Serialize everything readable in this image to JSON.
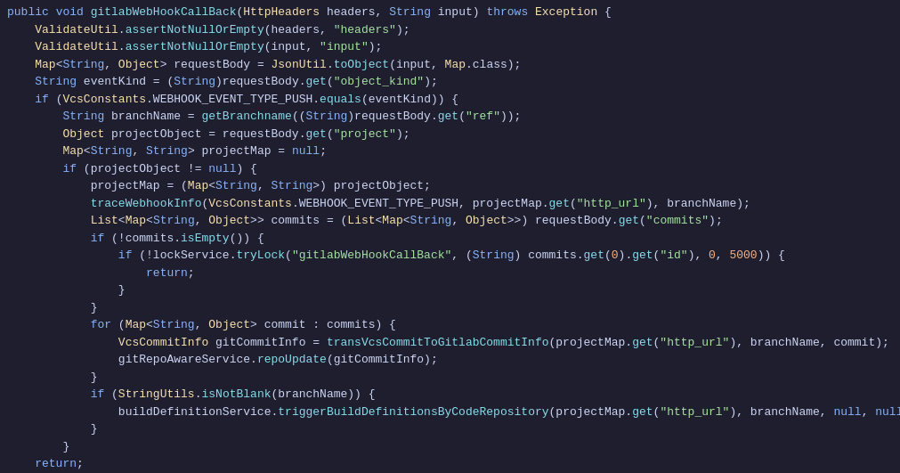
{
  "code": {
    "lines": [
      {
        "indent": 0,
        "tokens": [
          {
            "t": "public",
            "c": "kw"
          },
          {
            "t": " ",
            "c": "plain"
          },
          {
            "t": "void",
            "c": "kw"
          },
          {
            "t": " ",
            "c": "plain"
          },
          {
            "t": "gitlabWebHookCallBack",
            "c": "method"
          },
          {
            "t": "(",
            "c": "plain"
          },
          {
            "t": "HttpHeaders",
            "c": "type"
          },
          {
            "t": " headers, ",
            "c": "plain"
          },
          {
            "t": "String",
            "c": "kw"
          },
          {
            "t": " input) ",
            "c": "plain"
          },
          {
            "t": "throws",
            "c": "kw"
          },
          {
            "t": " ",
            "c": "plain"
          },
          {
            "t": "Exception",
            "c": "type"
          },
          {
            "t": " {",
            "c": "plain"
          }
        ]
      },
      {
        "indent": 1,
        "tokens": [
          {
            "t": "ValidateUtil",
            "c": "type"
          },
          {
            "t": ".",
            "c": "plain"
          },
          {
            "t": "assertNotNullOrEmpty",
            "c": "method"
          },
          {
            "t": "(headers, ",
            "c": "plain"
          },
          {
            "t": "\"headers\"",
            "c": "string"
          },
          {
            "t": ");",
            "c": "plain"
          }
        ]
      },
      {
        "indent": 1,
        "tokens": [
          {
            "t": "ValidateUtil",
            "c": "type"
          },
          {
            "t": ".",
            "c": "plain"
          },
          {
            "t": "assertNotNullOrEmpty",
            "c": "method"
          },
          {
            "t": "(input, ",
            "c": "plain"
          },
          {
            "t": "\"input\"",
            "c": "string"
          },
          {
            "t": ");",
            "c": "plain"
          }
        ]
      },
      {
        "indent": 1,
        "tokens": [
          {
            "t": "Map",
            "c": "type"
          },
          {
            "t": "<",
            "c": "plain"
          },
          {
            "t": "String",
            "c": "kw"
          },
          {
            "t": ", ",
            "c": "plain"
          },
          {
            "t": "Object",
            "c": "type"
          },
          {
            "t": "> requestBody = ",
            "c": "plain"
          },
          {
            "t": "JsonUtil",
            "c": "type"
          },
          {
            "t": ".",
            "c": "plain"
          },
          {
            "t": "toObject",
            "c": "method"
          },
          {
            "t": "(input, ",
            "c": "plain"
          },
          {
            "t": "Map",
            "c": "type"
          },
          {
            "t": ".class);",
            "c": "plain"
          }
        ]
      },
      {
        "indent": 1,
        "tokens": [
          {
            "t": "String",
            "c": "kw"
          },
          {
            "t": " eventKind = (",
            "c": "plain"
          },
          {
            "t": "String",
            "c": "kw"
          },
          {
            "t": ")requestBody.",
            "c": "plain"
          },
          {
            "t": "get",
            "c": "method"
          },
          {
            "t": "(",
            "c": "plain"
          },
          {
            "t": "\"object_kind\"",
            "c": "string"
          },
          {
            "t": ");",
            "c": "plain"
          }
        ]
      },
      {
        "indent": 1,
        "tokens": [
          {
            "t": "if",
            "c": "kw"
          },
          {
            "t": " (",
            "c": "plain"
          },
          {
            "t": "VcsConstants",
            "c": "type"
          },
          {
            "t": ".WEBHOOK_EVENT_TYPE_PUSH.",
            "c": "plain"
          },
          {
            "t": "equals",
            "c": "method"
          },
          {
            "t": "(eventKind)) {",
            "c": "plain"
          }
        ]
      },
      {
        "indent": 2,
        "tokens": [
          {
            "t": "String",
            "c": "kw"
          },
          {
            "t": " branchName = ",
            "c": "plain"
          },
          {
            "t": "getBranchname",
            "c": "method"
          },
          {
            "t": "((",
            "c": "plain"
          },
          {
            "t": "String",
            "c": "kw"
          },
          {
            "t": ")requestBody.",
            "c": "plain"
          },
          {
            "t": "get",
            "c": "method"
          },
          {
            "t": "(",
            "c": "plain"
          },
          {
            "t": "\"ref\"",
            "c": "string"
          },
          {
            "t": "));",
            "c": "plain"
          }
        ]
      },
      {
        "indent": 2,
        "tokens": [
          {
            "t": "Object",
            "c": "type"
          },
          {
            "t": " projectObject = requestBody.",
            "c": "plain"
          },
          {
            "t": "get",
            "c": "method"
          },
          {
            "t": "(",
            "c": "plain"
          },
          {
            "t": "\"project\"",
            "c": "string"
          },
          {
            "t": ");",
            "c": "plain"
          }
        ]
      },
      {
        "indent": 2,
        "tokens": [
          {
            "t": "Map",
            "c": "type"
          },
          {
            "t": "<",
            "c": "plain"
          },
          {
            "t": "String",
            "c": "kw"
          },
          {
            "t": ", ",
            "c": "plain"
          },
          {
            "t": "String",
            "c": "kw"
          },
          {
            "t": "> projectMap = ",
            "c": "plain"
          },
          {
            "t": "null",
            "c": "kw"
          },
          {
            "t": ";",
            "c": "plain"
          }
        ]
      },
      {
        "indent": 2,
        "tokens": [
          {
            "t": "if",
            "c": "kw"
          },
          {
            "t": " (projectObject != ",
            "c": "plain"
          },
          {
            "t": "null",
            "c": "kw"
          },
          {
            "t": ") {",
            "c": "plain"
          }
        ]
      },
      {
        "indent": 3,
        "tokens": [
          {
            "t": "projectMap = (",
            "c": "plain"
          },
          {
            "t": "Map",
            "c": "type"
          },
          {
            "t": "<",
            "c": "plain"
          },
          {
            "t": "String",
            "c": "kw"
          },
          {
            "t": ", ",
            "c": "plain"
          },
          {
            "t": "String",
            "c": "kw"
          },
          {
            "t": ">) projectObject;",
            "c": "plain"
          }
        ]
      },
      {
        "indent": 3,
        "tokens": [
          {
            "t": "traceWebhookInfo",
            "c": "method"
          },
          {
            "t": "(",
            "c": "plain"
          },
          {
            "t": "VcsConstants",
            "c": "type"
          },
          {
            "t": ".WEBHOOK_EVENT_TYPE_PUSH, projectMap.",
            "c": "plain"
          },
          {
            "t": "get",
            "c": "method"
          },
          {
            "t": "(",
            "c": "plain"
          },
          {
            "t": "\"http_url\"",
            "c": "string"
          },
          {
            "t": "), branchName);",
            "c": "plain"
          }
        ]
      },
      {
        "indent": 3,
        "tokens": [
          {
            "t": "List",
            "c": "type"
          },
          {
            "t": "<",
            "c": "plain"
          },
          {
            "t": "Map",
            "c": "type"
          },
          {
            "t": "<",
            "c": "plain"
          },
          {
            "t": "String",
            "c": "kw"
          },
          {
            "t": ", ",
            "c": "plain"
          },
          {
            "t": "Object",
            "c": "type"
          },
          {
            "t": ">> commits = (",
            "c": "plain"
          },
          {
            "t": "List",
            "c": "type"
          },
          {
            "t": "<",
            "c": "plain"
          },
          {
            "t": "Map",
            "c": "type"
          },
          {
            "t": "<",
            "c": "plain"
          },
          {
            "t": "String",
            "c": "kw"
          },
          {
            "t": ", ",
            "c": "plain"
          },
          {
            "t": "Object",
            "c": "type"
          },
          {
            "t": ">>) requestBody.",
            "c": "plain"
          },
          {
            "t": "get",
            "c": "method"
          },
          {
            "t": "(",
            "c": "plain"
          },
          {
            "t": "\"commits\"",
            "c": "string"
          },
          {
            "t": ");",
            "c": "plain"
          }
        ]
      },
      {
        "indent": 3,
        "tokens": [
          {
            "t": "if",
            "c": "kw"
          },
          {
            "t": " (!commits.",
            "c": "plain"
          },
          {
            "t": "isEmpty",
            "c": "method"
          },
          {
            "t": "()) {",
            "c": "plain"
          }
        ]
      },
      {
        "indent": 4,
        "tokens": [
          {
            "t": "if",
            "c": "kw"
          },
          {
            "t": " (!lockService.",
            "c": "plain"
          },
          {
            "t": "tryLock",
            "c": "method"
          },
          {
            "t": "(",
            "c": "plain"
          },
          {
            "t": "\"gitlabWebHookCallBack\"",
            "c": "string"
          },
          {
            "t": ", (",
            "c": "plain"
          },
          {
            "t": "String",
            "c": "kw"
          },
          {
            "t": ") commits.",
            "c": "plain"
          },
          {
            "t": "get",
            "c": "method"
          },
          {
            "t": "(",
            "c": "plain"
          },
          {
            "t": "0",
            "c": "num"
          },
          {
            "t": ").",
            "c": "plain"
          },
          {
            "t": "get",
            "c": "method"
          },
          {
            "t": "(",
            "c": "plain"
          },
          {
            "t": "\"id\"",
            "c": "string"
          },
          {
            "t": "), ",
            "c": "plain"
          },
          {
            "t": "0",
            "c": "num"
          },
          {
            "t": ", ",
            "c": "plain"
          },
          {
            "t": "5000",
            "c": "num"
          },
          {
            "t": ")) {",
            "c": "plain"
          }
        ]
      },
      {
        "indent": 5,
        "tokens": [
          {
            "t": "return",
            "c": "kw"
          },
          {
            "t": ";",
            "c": "plain"
          }
        ]
      },
      {
        "indent": 4,
        "tokens": [
          {
            "t": "}",
            "c": "plain"
          }
        ]
      },
      {
        "indent": 3,
        "tokens": [
          {
            "t": "}",
            "c": "plain"
          }
        ]
      },
      {
        "indent": 3,
        "tokens": [
          {
            "t": "for",
            "c": "kw"
          },
          {
            "t": " (",
            "c": "plain"
          },
          {
            "t": "Map",
            "c": "type"
          },
          {
            "t": "<",
            "c": "plain"
          },
          {
            "t": "String",
            "c": "kw"
          },
          {
            "t": ", ",
            "c": "plain"
          },
          {
            "t": "Object",
            "c": "type"
          },
          {
            "t": "> commit : commits) {",
            "c": "plain"
          }
        ]
      },
      {
        "indent": 4,
        "tokens": [
          {
            "t": "VcsCommitInfo",
            "c": "type"
          },
          {
            "t": " gitCommitInfo = ",
            "c": "plain"
          },
          {
            "t": "transVcsCommitToGitlabCommitInfo",
            "c": "method"
          },
          {
            "t": "(projectMap.",
            "c": "plain"
          },
          {
            "t": "get",
            "c": "method"
          },
          {
            "t": "(",
            "c": "plain"
          },
          {
            "t": "\"http_url\"",
            "c": "string"
          },
          {
            "t": "), branchName, commit);",
            "c": "plain"
          }
        ]
      },
      {
        "indent": 4,
        "tokens": [
          {
            "t": "gitRepoAwareService",
            "c": "plain"
          },
          {
            "t": ".",
            "c": "plain"
          },
          {
            "t": "repoUpdate",
            "c": "method"
          },
          {
            "t": "(gitCommitInfo);",
            "c": "plain"
          }
        ]
      },
      {
        "indent": 3,
        "tokens": [
          {
            "t": "}",
            "c": "plain"
          }
        ]
      },
      {
        "indent": 3,
        "tokens": [
          {
            "t": "if",
            "c": "kw"
          },
          {
            "t": " (",
            "c": "plain"
          },
          {
            "t": "StringUtils",
            "c": "type"
          },
          {
            "t": ".",
            "c": "plain"
          },
          {
            "t": "isNotBlank",
            "c": "method"
          },
          {
            "t": "(branchName)) {",
            "c": "plain"
          }
        ]
      },
      {
        "indent": 4,
        "tokens": [
          {
            "t": "buildDefinitionService",
            "c": "plain"
          },
          {
            "t": ".",
            "c": "plain"
          },
          {
            "t": "triggerBuildDefinitionsByCodeRepository",
            "c": "method"
          },
          {
            "t": "(projectMap.",
            "c": "plain"
          },
          {
            "t": "get",
            "c": "method"
          },
          {
            "t": "(",
            "c": "plain"
          },
          {
            "t": "\"http_url\"",
            "c": "string"
          },
          {
            "t": "), branchName, ",
            "c": "plain"
          },
          {
            "t": "null",
            "c": "kw"
          },
          {
            "t": ", ",
            "c": "plain"
          },
          {
            "t": "null",
            "c": "kw"
          },
          {
            "t": ",",
            "c": "plain"
          }
        ]
      },
      {
        "indent": 3,
        "tokens": [
          {
            "t": "}",
            "c": "plain"
          }
        ]
      },
      {
        "indent": 2,
        "tokens": [
          {
            "t": "}",
            "c": "plain"
          }
        ]
      },
      {
        "indent": 1,
        "tokens": [
          {
            "t": "return",
            "c": "kw"
          },
          {
            "t": ";",
            "c": "plain"
          }
        ]
      },
      {
        "indent": 0,
        "tokens": [
          {
            "t": "}",
            "c": "plain"
          }
        ]
      }
    ],
    "indent_size": 4
  }
}
